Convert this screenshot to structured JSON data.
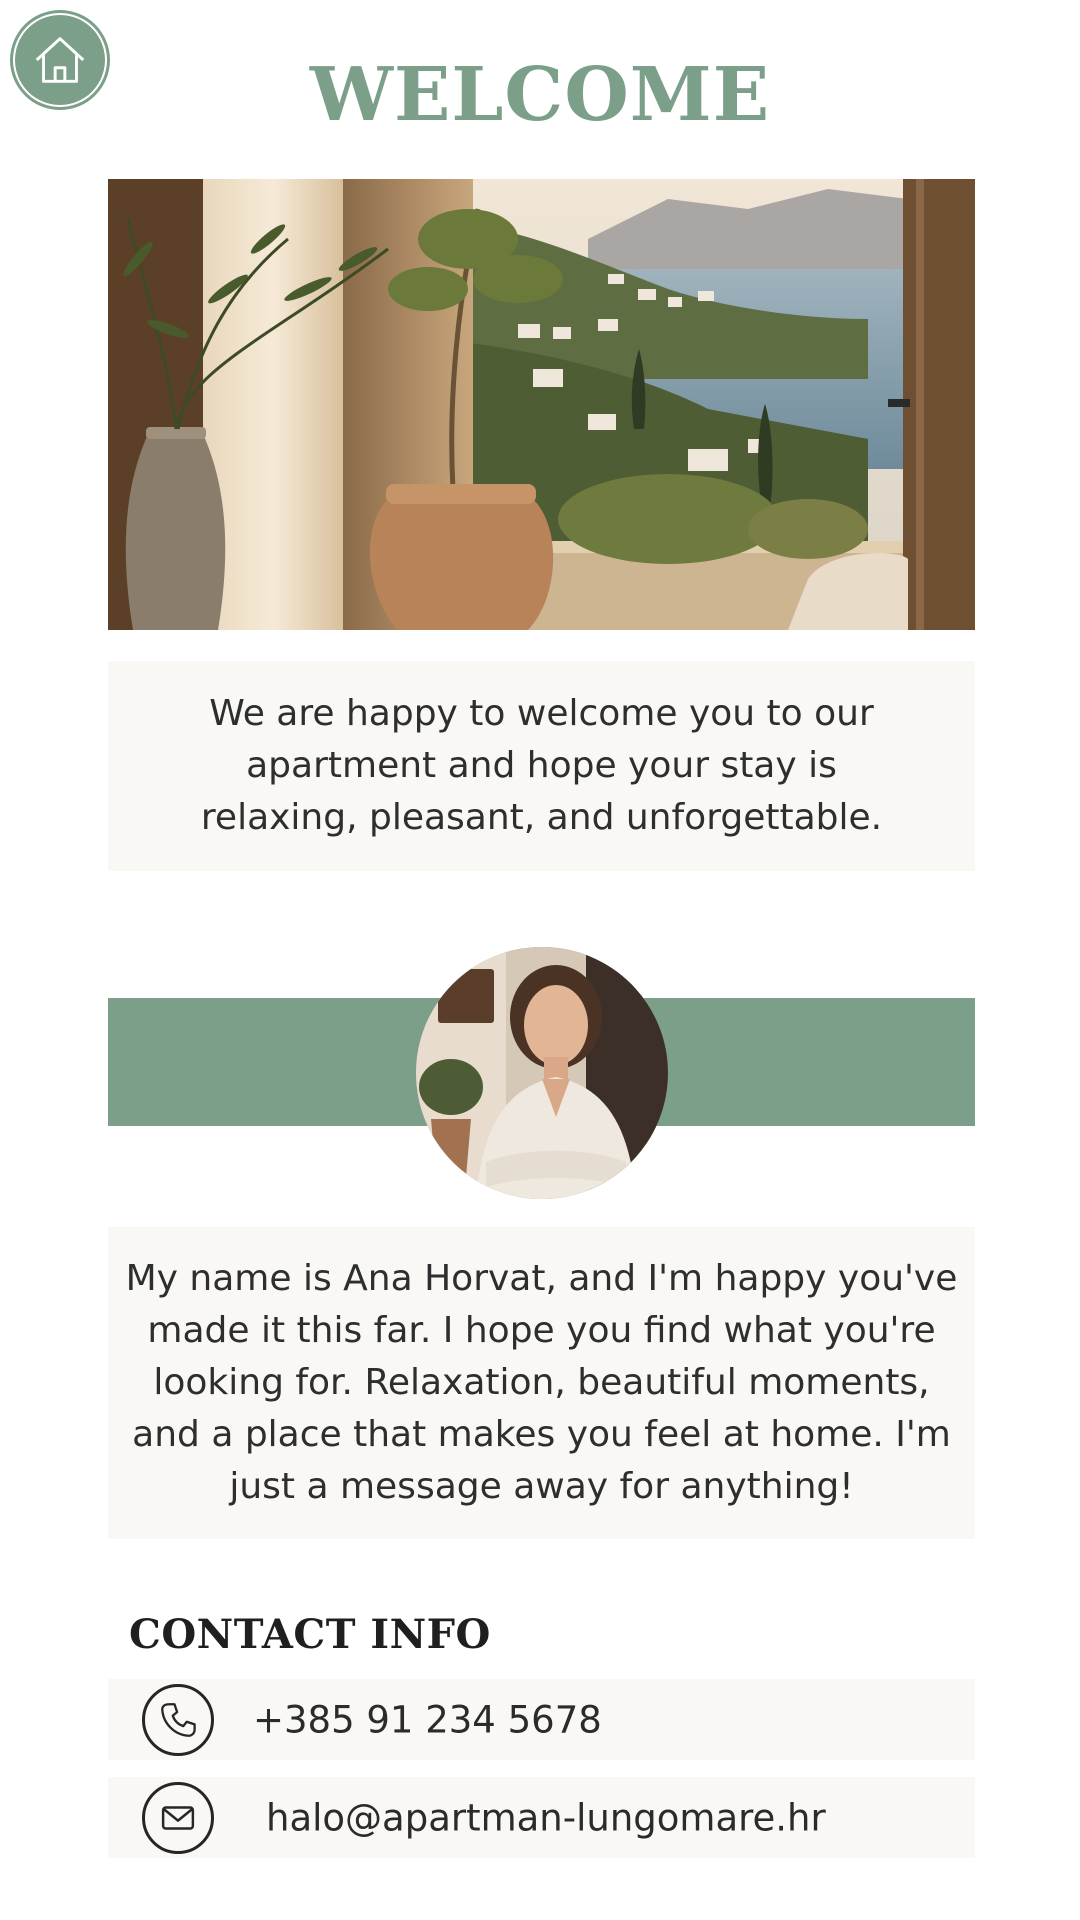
{
  "header": {
    "home_icon": "home-icon",
    "title": "WELCOME"
  },
  "hero": {
    "image": "mediterranean-terrace-sea-view-photo"
  },
  "welcome_message": "We are happy to welcome you to our apartment and hope your stay is relaxing, pleasant, and unforgettable.",
  "host": {
    "avatar": "host-portrait-photo",
    "message": "My name is Ana Horvat, and I'm happy you've made it this far. I hope you find what you're looking for. Relaxation, beautiful moments, and a place that makes you feel at home. I'm just a message away for anything!"
  },
  "contact": {
    "heading": "CONTACT INFO",
    "phone": {
      "icon": "phone-icon",
      "value": "+385 91 234 5678"
    },
    "email": {
      "icon": "mail-icon",
      "value": "halo@apartman-lungomare.hr"
    }
  },
  "colors": {
    "accent": "#7c9f8a",
    "card_background": "#f9f8f5",
    "text": "#2b2b2b"
  }
}
